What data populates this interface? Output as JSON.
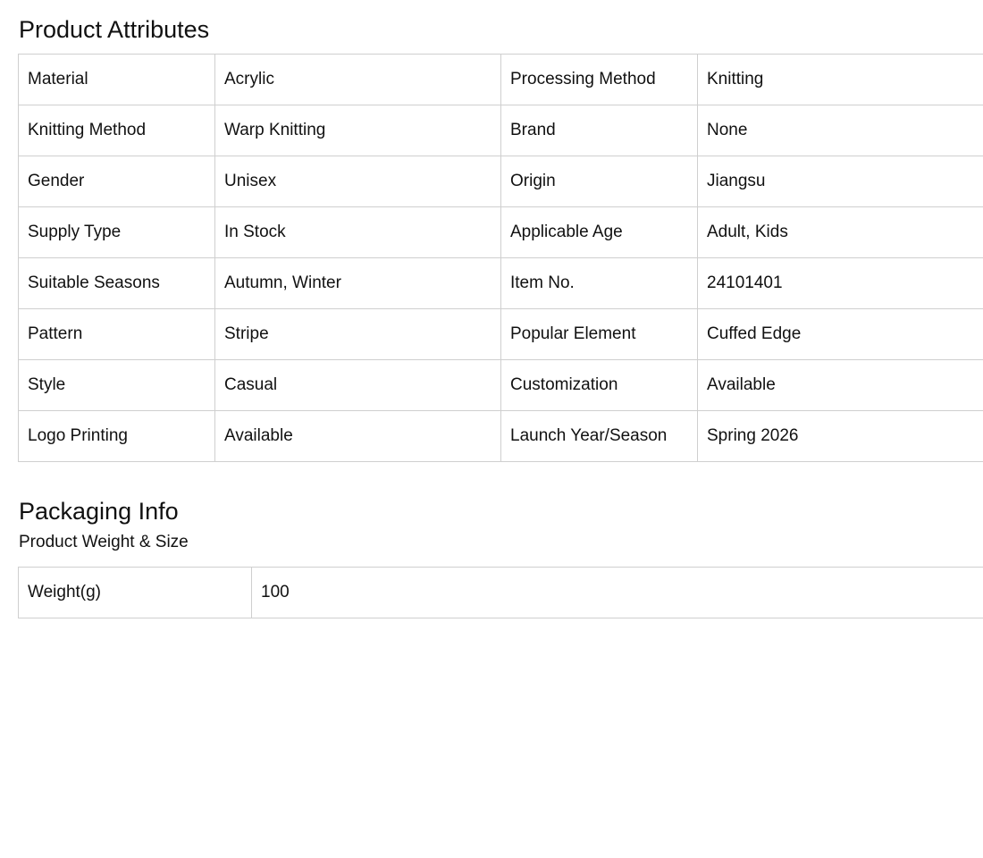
{
  "product_attributes": {
    "title": "Product Attributes",
    "rows": [
      {
        "k1": "Material",
        "v1": "Acrylic",
        "k2": "Processing Method",
        "v2": "Knitting"
      },
      {
        "k1": "Knitting Method",
        "v1": "Warp Knitting",
        "k2": "Brand",
        "v2": "None"
      },
      {
        "k1": "Gender",
        "v1": "Unisex",
        "k2": "Origin",
        "v2": "Jiangsu"
      },
      {
        "k1": "Supply Type",
        "v1": "In Stock",
        "k2": "Applicable Age",
        "v2": "Adult, Kids"
      },
      {
        "k1": "Suitable Seasons",
        "v1": "Autumn, Winter",
        "k2": "Item No.",
        "v2": "24101401"
      },
      {
        "k1": "Pattern",
        "v1": "Stripe",
        "k2": "Popular Element",
        "v2": "Cuffed Edge"
      },
      {
        "k1": "Style",
        "v1": "Casual",
        "k2": "Customization",
        "v2": "Available"
      },
      {
        "k1": "Logo Printing",
        "v1": "Available",
        "k2": "Launch Year/Season",
        "v2": "Spring 2026"
      }
    ]
  },
  "packaging_info": {
    "title": "Packaging Info",
    "subtitle": "Product Weight & Size",
    "rows": [
      {
        "label": "Weight(g)",
        "value": "100"
      }
    ]
  },
  "colors": {
    "text": "#111111",
    "border": "#cfcfcf",
    "background": "#ffffff"
  }
}
